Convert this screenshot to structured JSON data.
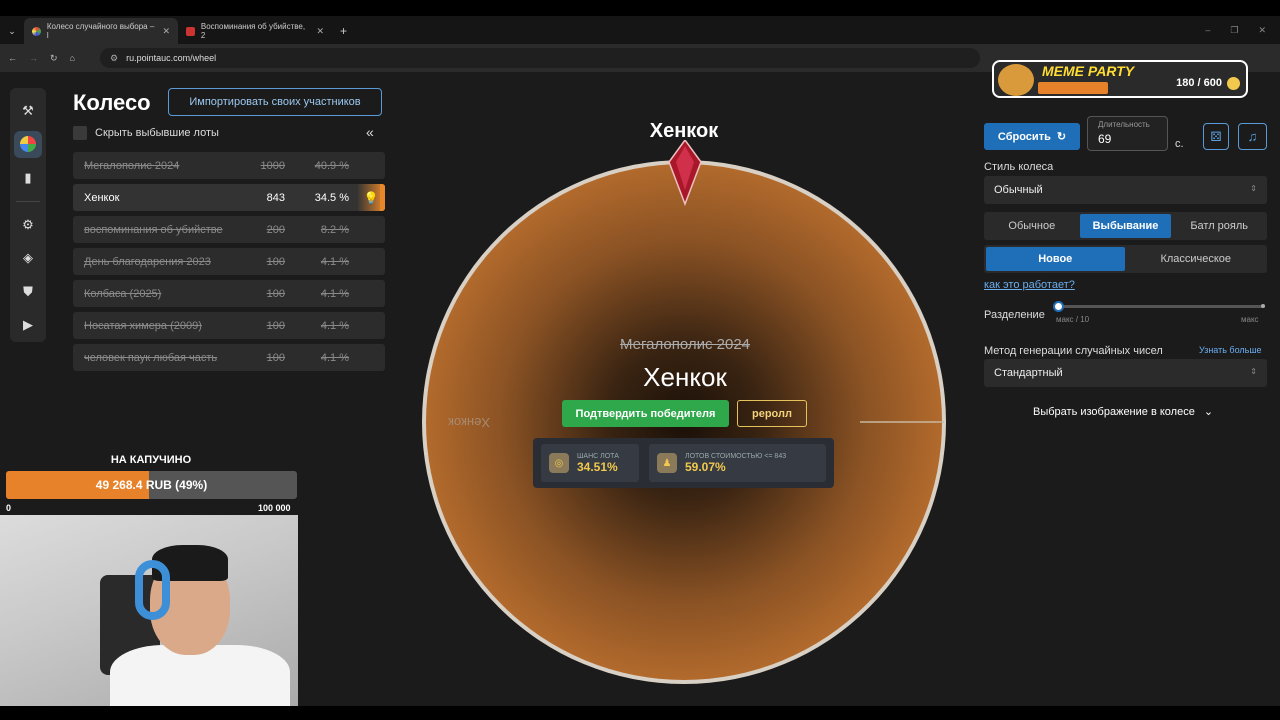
{
  "browser": {
    "tabs": [
      {
        "title": "Колесо случайного выбора – l",
        "active": true
      },
      {
        "title": "Воспоминания об убийстве, 2",
        "active": false
      }
    ],
    "new_tab": "+",
    "url": "ru.pointauc.com/wheel"
  },
  "header": {
    "title": "Колесо",
    "import_label": "Импортировать своих участников"
  },
  "lot_list": {
    "hide_label": "Скрыть выбывшие лоты",
    "items": [
      {
        "name": "Мегалополис 2024",
        "amount": "1000",
        "percent": "40.9 %",
        "eliminated": true
      },
      {
        "name": "Хенкок",
        "amount": "843",
        "percent": "34.5 %",
        "eliminated": false
      },
      {
        "name": "воспоминания об убийстве",
        "amount": "200",
        "percent": "8.2 %",
        "eliminated": true
      },
      {
        "name": "День благодарения 2023",
        "amount": "100",
        "percent": "4.1 %",
        "eliminated": true
      },
      {
        "name": "Колбаса (2025)",
        "amount": "100",
        "percent": "4.1 %",
        "eliminated": true
      },
      {
        "name": "Носатая химера (2009)",
        "amount": "100",
        "percent": "4.1 %",
        "eliminated": true
      },
      {
        "name": "человек паук любая часть",
        "amount": "100",
        "percent": "4.1 %",
        "eliminated": true
      }
    ]
  },
  "goal": {
    "title": "НА КАПУЧИНО",
    "text": "49 268.4 RUB (49%)",
    "progress": 0.49,
    "min": "0",
    "max": "100 000"
  },
  "wheel": {
    "winner_top": "Хенкок",
    "slice_label": "Хенкок",
    "eliminated_label": "Мегалополис 2024",
    "winner_label": "Хенкок",
    "confirm_label": "Подтвердить победителя",
    "reroll_label": "реролл",
    "stats": [
      {
        "label": "ШАНС ЛОТА",
        "value": "34.51%"
      },
      {
        "label": "ЛОТОВ СТОИМОСТЬЮ <= 843",
        "value": "59.07%"
      }
    ],
    "slice_color": "#a8622a"
  },
  "overlay": {
    "brand": "MEME PARTY",
    "count": "180 / 600"
  },
  "settings": {
    "reset_label": "Сбросить",
    "duration_label": "Длительность",
    "duration_value": "69",
    "seconds_unit": "с.",
    "style_label": "Стиль колеса",
    "style_value": "Обычный",
    "mode_options": [
      {
        "label": "Обычное",
        "selected": false
      },
      {
        "label": "Выбывание",
        "selected": true
      },
      {
        "label": "Батл рояль",
        "selected": false
      }
    ],
    "variant_options": [
      {
        "label": "Новое",
        "selected": true
      },
      {
        "label": "Классическое",
        "selected": false
      }
    ],
    "how_link": "как это работает?",
    "split_label": "Разделение",
    "split_min": "макс / 10",
    "split_max": "макс",
    "rng_label": "Метод генерации случайных чисел",
    "rng_learn": "Узнать больше",
    "rng_value": "Стандартный",
    "image_picker": "Выбрать изображение в колесе"
  }
}
